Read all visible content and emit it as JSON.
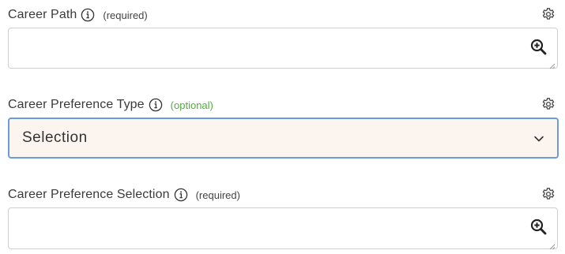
{
  "fields": [
    {
      "label": "Career Path",
      "tag": "(required)",
      "value": ""
    },
    {
      "label": "Career Preference Type",
      "tag": "(optional)",
      "value": "Selection"
    },
    {
      "label": "Career Preference Selection",
      "tag": "(required)",
      "value": ""
    }
  ],
  "icons": {
    "info": "info-icon",
    "settings": "gear-icon",
    "lookup": "zoom-in-icon",
    "dropdown": "chevron-down-icon",
    "resize": "resize-handle-icon"
  },
  "colors": {
    "optional_tag": "#4fae3c",
    "focus_border": "#6b9bd9",
    "select_background": "#fcf5ef"
  }
}
